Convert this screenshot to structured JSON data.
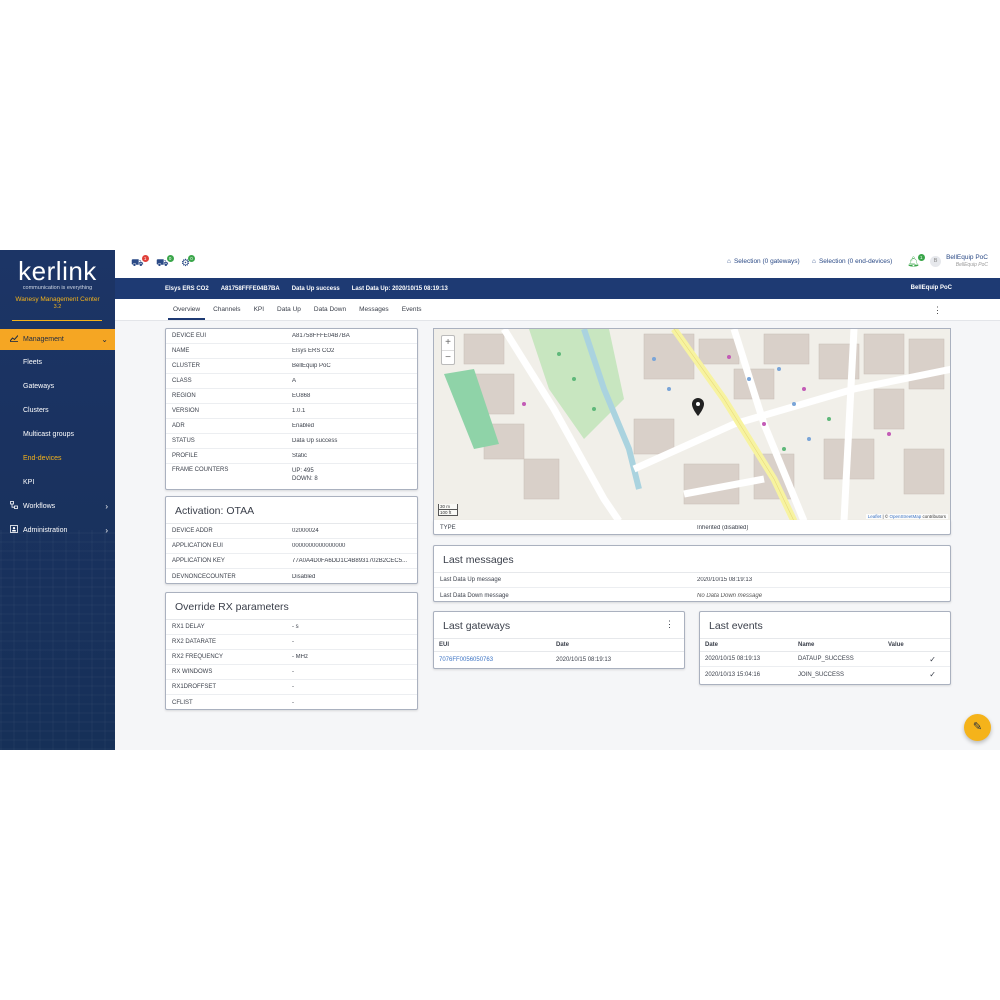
{
  "sidebar": {
    "logo_word": "kerlink",
    "logo_tagline": "communication is everything",
    "product": "Wanesy Management Center",
    "version": "3.2",
    "items": [
      {
        "label": "Management",
        "icon": "chart-line-icon"
      },
      {
        "label": "Fleets"
      },
      {
        "label": "Gateways"
      },
      {
        "label": "Clusters"
      },
      {
        "label": "Multicast groups"
      },
      {
        "label": "End-devices"
      },
      {
        "label": "KPI"
      },
      {
        "label": "Workflows",
        "icon": "workflow-icon"
      },
      {
        "label": "Administration",
        "icon": "admin-icon"
      }
    ]
  },
  "topbar": {
    "badges": [
      "1",
      "0",
      "0"
    ],
    "selection_gateways": "Selection (0 gateways)",
    "selection_devices": "Selection (0 end-devices)",
    "notification_count": "1",
    "avatar_initial": "B",
    "user_name": "BellEquip PoC",
    "user_sub": "BellEquip PoC"
  },
  "device_bar": {
    "name": "Elsys ERS CO2",
    "eui": "A81758FFFE04B7BA",
    "status": "Data Up success",
    "last_data": "Last Data Up: 2020/10/15 08:19:13",
    "cluster": "BellEquip PoC"
  },
  "tabs": [
    "Overview",
    "Channels",
    "KPI",
    "Data Up",
    "Data Down",
    "Messages",
    "Events"
  ],
  "device_info": [
    {
      "k": "DEVICE EUI",
      "v": "A81758FFFE04B7BA"
    },
    {
      "k": "NAME",
      "v": "Elsys ERS CO2"
    },
    {
      "k": "CLUSTER",
      "v": "BellEquip PoC"
    },
    {
      "k": "CLASS",
      "v": "A"
    },
    {
      "k": "REGION",
      "v": "EU868"
    },
    {
      "k": "VERSION",
      "v": "1.0.1"
    },
    {
      "k": "ADR",
      "v": "Enabled"
    },
    {
      "k": "STATUS",
      "v": "Data Up success"
    },
    {
      "k": "PROFILE",
      "v": "Static"
    }
  ],
  "frame_counters": {
    "k": "FRAME COUNTERS",
    "up": "UP: 495",
    "down": "DOWN: 8"
  },
  "activation": {
    "title": "Activation: OTAA",
    "rows": [
      {
        "k": "DEVICE ADDR",
        "v": "02000024"
      },
      {
        "k": "APPLICATION EUI",
        "v": "0000000000000000"
      },
      {
        "k": "APPLICATION KEY",
        "v": "77A0A4D0FA6DD1C4B8931702B2CEC5..."
      },
      {
        "k": "DEVNONCECOUNTER",
        "v": "Disabled"
      }
    ]
  },
  "rx": {
    "title": "Override RX parameters",
    "rows": [
      {
        "k": "RX1 DELAY",
        "v": "- s"
      },
      {
        "k": "RX2 DATARATE",
        "v": "-"
      },
      {
        "k": "RX2 FREQUENCY",
        "v": "- MHz"
      },
      {
        "k": "RX WINDOWS",
        "v": "-"
      },
      {
        "k": "RX1DROFFSET",
        "v": "-"
      },
      {
        "k": "CFLIST",
        "v": "-"
      }
    ]
  },
  "map": {
    "zoom_in": "+",
    "zoom_out": "−",
    "scale_m": "30 m",
    "scale_ft": "100 ft",
    "attribution_leaflet": "Leaflet",
    "attribution_sep": " | © ",
    "attribution_osm": "OpenStreetMap",
    "attribution_tail": " contributors",
    "type_label": "TYPE",
    "type_value": "Inherited (disabled)"
  },
  "last_messages": {
    "title": "Last messages",
    "rows": [
      {
        "k": "Last Data Up message",
        "v": "2020/10/15 08:19:13"
      },
      {
        "k": "Last Data Down message",
        "v": "No Data Down message"
      }
    ]
  },
  "last_gateways": {
    "title": "Last gateways",
    "col_eui": "EUI",
    "col_date": "Date",
    "rows": [
      {
        "eui": "7076FF0056050763",
        "date": "2020/10/15 08:19:13"
      }
    ]
  },
  "last_events": {
    "title": "Last events",
    "col_date": "Date",
    "col_name": "Name",
    "col_value": "Value",
    "rows": [
      {
        "date": "2020/10/15 08:19:13",
        "name": "DATAUP_SUCCESS",
        "value": "✓"
      },
      {
        "date": "2020/10/13 15:04:16",
        "name": "JOIN_SUCCESS",
        "value": "✓"
      }
    ]
  },
  "colors": {
    "accent": "#f5a623",
    "navy": "#1e3a73",
    "link": "#3b73c4"
  }
}
